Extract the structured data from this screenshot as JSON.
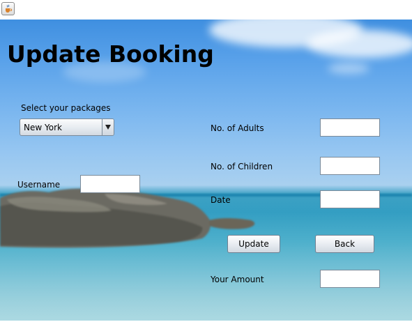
{
  "window": {
    "icon": "java-cup-icon"
  },
  "form": {
    "title": "Update Booking",
    "packages": {
      "label": "Select your packages",
      "selected": "New York"
    },
    "username": {
      "label": "Username",
      "value": ""
    },
    "adults": {
      "label": "No. of Adults",
      "value": ""
    },
    "children": {
      "label": "No. of Children",
      "value": ""
    },
    "date": {
      "label": "Date",
      "value": ""
    },
    "amount": {
      "label": "Your Amount",
      "value": ""
    },
    "buttons": {
      "update": "Update",
      "back": "Back"
    }
  }
}
